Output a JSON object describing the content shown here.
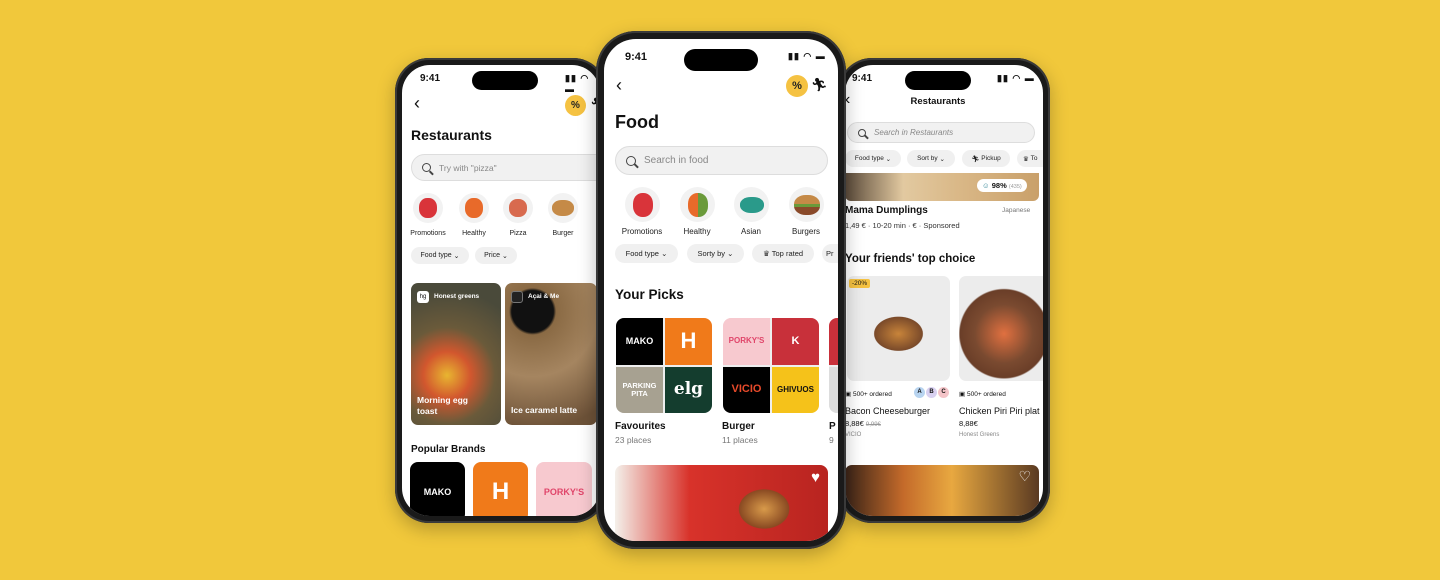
{
  "background_color": "#F1C83B",
  "accent_color": "#F5C242",
  "left_phone": {
    "status_time": "9:41",
    "status_icons": "signal wifi battery",
    "back_icon": "chevron-left",
    "delivery_icon": "percent-scooter",
    "title": "Restaurants",
    "search_placeholder": "Try with \"pizza\"",
    "categories": [
      "Promotions",
      "Healthy",
      "Pizza",
      "Burger"
    ],
    "filters": [
      "Food type",
      "Price"
    ],
    "cards": [
      {
        "brand": "Honest greens",
        "brand_logo": "hg",
        "title": "Morning egg toast"
      },
      {
        "brand": "Açai & Me",
        "title": "Ice caramel latte"
      }
    ],
    "section_title": "Popular Brands",
    "brands": [
      "MAKO",
      "H",
      "PORKY'S"
    ]
  },
  "center_phone": {
    "status_time": "9:41",
    "title": "Food",
    "search_placeholder": "Search in food",
    "categories": [
      "Promotions",
      "Healthy",
      "Asian",
      "Burgers"
    ],
    "filters": [
      "Food type",
      "Sorty by",
      "Top rated",
      "Pr"
    ],
    "section_title": "Your Picks",
    "picks": [
      {
        "title": "Favourites",
        "count": "23 places",
        "logos": [
          "MAKO",
          "H",
          "PARKING PITA",
          "elg"
        ]
      },
      {
        "title": "Burger",
        "count": "11 places",
        "logos": [
          "PORKY'S",
          "K",
          "VICIO",
          "GHIVUOS"
        ]
      },
      {
        "title": "P",
        "count": "9"
      }
    ]
  },
  "right_phone": {
    "status_time": "9:41",
    "title": "Restaurants",
    "search_placeholder": "Search in Restaurants",
    "filters": [
      "Food type",
      "Sort by",
      "Pickup",
      "To"
    ],
    "featured": {
      "rating": "98%",
      "rating_count": "(435)",
      "name": "Mama Dumplings",
      "cuisine": "Japanese",
      "info": "1,49 € · 10-20 min · € · Sponsored"
    },
    "section_title": "Your friends' top choice",
    "items": [
      {
        "discount": "-20%",
        "ordered": "500+ ordered",
        "friends": [
          "A",
          "B",
          "C"
        ],
        "name": "Bacon Cheeseburger",
        "price": "8,88€",
        "old_price": "9,99€",
        "brand": "VICIO"
      },
      {
        "ordered": "500+ ordered",
        "name": "Chicken Piri Piri plat",
        "price": "8,88€",
        "brand": "Honest Greens"
      }
    ]
  }
}
